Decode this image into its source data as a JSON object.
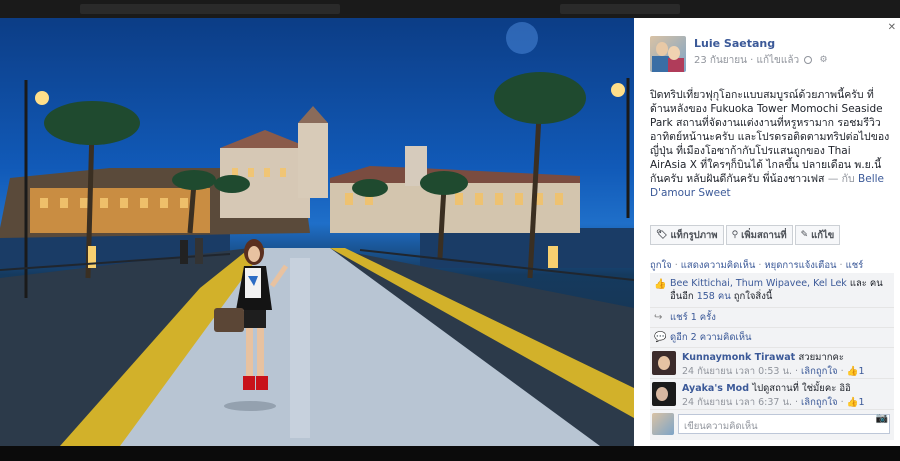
{
  "post": {
    "author": "Luie Saetang",
    "date": "23 กันยายน",
    "edited": "แก้ไขแล้ว",
    "caption_main": "ปิดทริปเที่ยวฟุกุโอกะแบบสมบูรณ์ด้วยภาพนี้ครับ ที่ด้านหลังของ Fukuoka Tower Momochi Seaside Park สถานที่จัดงานแต่งงานที่หรูหรามาก รอชมรีวิวอาทิตย์หน้านะครับ และโปรดรอติดตามทริปต่อไปของญี่ปุ่น ที่เมืองโอซาก้ากับโปรแสนถูกของ Thai AirAsia X ที่ใครๆก็บินได้ ไกลขึ้น ปลายเดือน พ.ย.นี้กันครับ หลับฝันดีกันครับ พี่น้องชาวเฟส",
    "with_sep": "— กับ",
    "with_name": "Belle D'amour Sweet"
  },
  "actions": {
    "tag": "แท็กรูปภาพ",
    "location": "เพิ่มสถานที่",
    "edit": "แก้ไข"
  },
  "links": {
    "like": "ถูกใจ",
    "comment": "แสดงความคิดเห็น",
    "stop": "หยุดการแจ้งเตือน",
    "share": "แชร์",
    "sep": " · "
  },
  "ufi": {
    "likes_names": "Bee Kittichai, Thum Wipavee, Kel Lek",
    "likes_and": " และ คนอื่นอีก ",
    "likes_count": "158 คน",
    "likes_end": " ถูกใจสิ่งนี้",
    "shares": "แชร์ 1 ครั้ง",
    "view_comments": "ดูอีก 2 ความคิดเห็น"
  },
  "comments": [
    {
      "name": "Kunnaymonk Tirawat",
      "text": "สวยมากคะ",
      "time": "24 กันยายน เวลา 0:53 น.",
      "unlike": "เลิกถูกใจ",
      "likes": "1"
    },
    {
      "name": "Ayaka's Mod",
      "text": "ไปดูสถานที่ ใช่มั้ยคะ อิอิ",
      "time": "24 กันยายน เวลา 6:37 น.",
      "unlike": "เลิกถูกใจ",
      "likes": "1"
    }
  ],
  "composer": {
    "placeholder": "เขียนความคิดเห็น"
  },
  "icons": {
    "close": "close-icon",
    "tag": "tag-icon",
    "location": "location-pin-icon",
    "edit": "pencil-icon",
    "like": "thumbs-up-icon",
    "share": "share-icon",
    "comment": "comment-icon",
    "camera": "camera-icon"
  },
  "colors": {
    "link": "#3b5998",
    "text": "#1d2129",
    "muted": "#90949c"
  }
}
